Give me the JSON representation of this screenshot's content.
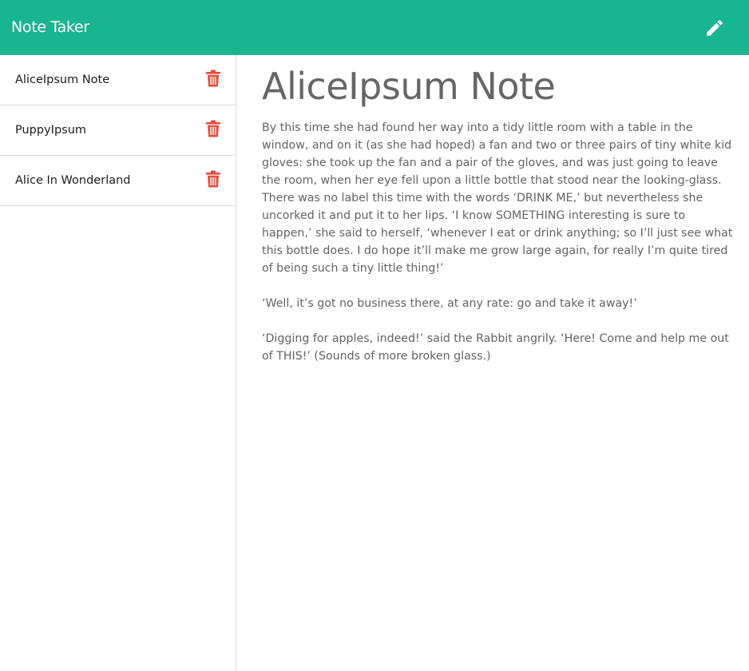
{
  "app": {
    "title": "Note Taker"
  },
  "colors": {
    "navbar": "#19b591",
    "delete_icon": "#e74c3c",
    "heading": "#666666",
    "body_text": "#636363"
  },
  "navbar": {
    "new_note_icon": "pencil-icon"
  },
  "sidebar": {
    "notes": [
      {
        "title": "AliceIpsum Note",
        "delete_icon": "trash-icon"
      },
      {
        "title": "PuppyIpsum",
        "delete_icon": "trash-icon"
      },
      {
        "title": "Alice In Wonderland",
        "delete_icon": "trash-icon"
      }
    ]
  },
  "active_note": {
    "title": "AliceIpsum Note",
    "paragraphs": [
      "By this time she had found her way into a tidy little room with a table in the window, and on it (as she had hoped) a fan and two or three pairs of tiny white kid gloves: she took up the fan and a pair of the gloves, and was just going to leave the room, when her eye fell upon a little bottle that stood near the looking-glass. There was no label this time with the words ‘DRINK ME,’ but nevertheless she uncorked it and put it to her lips. ‘I know SOMETHING interesting is sure to happen,’ she said to herself, ‘whenever I eat or drink anything; so I’ll just see what this bottle does. I do hope it’ll make me grow large again, for really I’m quite tired of being such a tiny little thing!’",
      "‘Well, it’s got no business there, at any rate: go and take it away!’",
      "‘Digging for apples, indeed!’ said the Rabbit angrily. ‘Here! Come and help me out of THIS!’ (Sounds of more broken glass.)"
    ]
  }
}
